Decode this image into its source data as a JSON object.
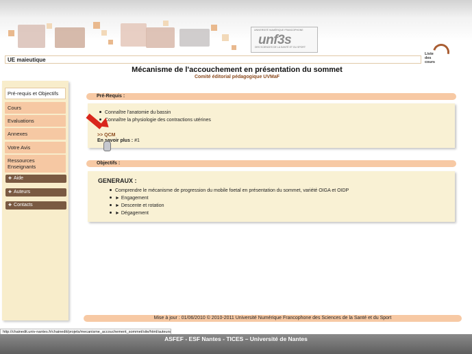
{
  "header": {
    "logo_top_text": "UNIVERSITÉ NUMÉRIQUE FRANCOPHONE",
    "logo_main": "unf3s",
    "logo_sub": "DES SCIENCES DE LA SANTÉ ET DU SPORT",
    "liste_cours_line1": "Liste",
    "liste_cours_line2": "des",
    "liste_cours_line3": "cours"
  },
  "ue_title": "UE maieutique",
  "page": {
    "title": "Mécanisme de l'accouchement en présentation du sommet",
    "subtitle": "Comité éditorial pédagogique UVMaF"
  },
  "sidebar": {
    "items": [
      {
        "label": "Pré-requis et Objectifs"
      },
      {
        "label": "Cours"
      },
      {
        "label": "Evaluations"
      },
      {
        "label": "Annexes"
      },
      {
        "label": "Votre Avis"
      },
      {
        "label": "Ressources Enseignants"
      }
    ],
    "dark_items": [
      {
        "label": "Aide"
      },
      {
        "label": "Auteurs"
      },
      {
        "label": "Contacts"
      }
    ]
  },
  "prerequis": {
    "heading": "Pré-Requis :",
    "items": [
      "Connaître l'anatomie du bassin",
      "Connaître la physiologie des contractions utérines"
    ],
    "qcm": ">> QCM",
    "ensavoir_label": "En savoir plus :",
    "ensavoir_link": "#1"
  },
  "objectifs": {
    "heading": "Objectifs :",
    "generaux": "GENERAUX :",
    "items": [
      "Comprendre le mécanisme de progression du mobile foetal en présentation du sommet, variété OIGA et OIDP",
      "► Engagement",
      "► Descente et rotation",
      "► Dégagement"
    ]
  },
  "footer": "Mise à jour : 01/06/2010 © 2010-2011 Université Numérique Francophone des Sciences de la Santé et du Sport",
  "status_url": "http://chainedit.univ-nantes.fr/chainedit/projets/mecanisme_accouchement_sommet/site/html/auteurs.html",
  "bottom_banner": "ASFEF - ESF Nantes - TICES – Université de Nantes"
}
